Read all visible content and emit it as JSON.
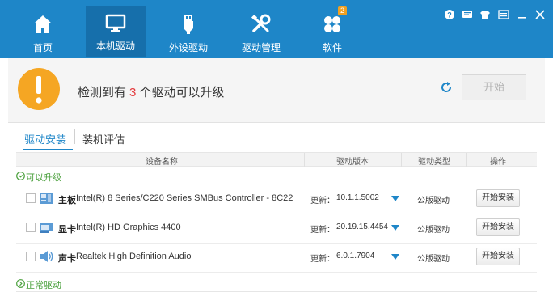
{
  "colors": {
    "topbar": "#1e86c8",
    "active_nav": "#166fab",
    "accent": "#1e86c8",
    "alert_icon": "#f5a623",
    "highlight_count": "#e4393c",
    "group_green": "#4aa03c"
  },
  "nav": {
    "items": [
      {
        "label": "首页",
        "icon": "home-icon"
      },
      {
        "label": "本机驱动",
        "icon": "monitor-icon"
      },
      {
        "label": "外设驱动",
        "icon": "usb-icon"
      },
      {
        "label": "驱动管理",
        "icon": "tools-icon"
      },
      {
        "label": "软件",
        "icon": "apps-icon",
        "badge": "2"
      }
    ],
    "active_index": 1
  },
  "window_controls": [
    "help-icon",
    "feedback-icon",
    "skin-icon",
    "menu-icon",
    "minimize-icon",
    "close-icon"
  ],
  "alert": {
    "text_before": "检测到有",
    "count": "3",
    "text_after": "个驱动可以升级",
    "start_button": "开始"
  },
  "tabs": [
    {
      "label": "驱动安装"
    },
    {
      "label": "装机评估"
    }
  ],
  "table": {
    "headers": [
      "设备名称",
      "驱动版本",
      "驱动类型",
      "操作"
    ],
    "group_upgradable": "可以升级",
    "group_normal": "正常驱动",
    "rows": [
      {
        "type": "主板",
        "name": "Intel(R) 8 Series/C220 Series SMBus Controller - 8C22",
        "ver_prefix": "更新：",
        "version": "10.1.1.5002",
        "driver_type": "公版驱动",
        "action": "开始安装",
        "icon": "motherboard-icon"
      },
      {
        "type": "显卡",
        "name": "Intel(R) HD Graphics 4400",
        "ver_prefix": "更新：",
        "version": "20.19.15.4454",
        "driver_type": "公版驱动",
        "action": "开始安装",
        "icon": "graphics-card-icon"
      },
      {
        "type": "声卡",
        "name": "Realtek High Definition Audio",
        "ver_prefix": "更新：",
        "version": "6.0.1.7904",
        "driver_type": "公版驱动",
        "action": "开始安装",
        "icon": "speaker-icon"
      }
    ]
  }
}
